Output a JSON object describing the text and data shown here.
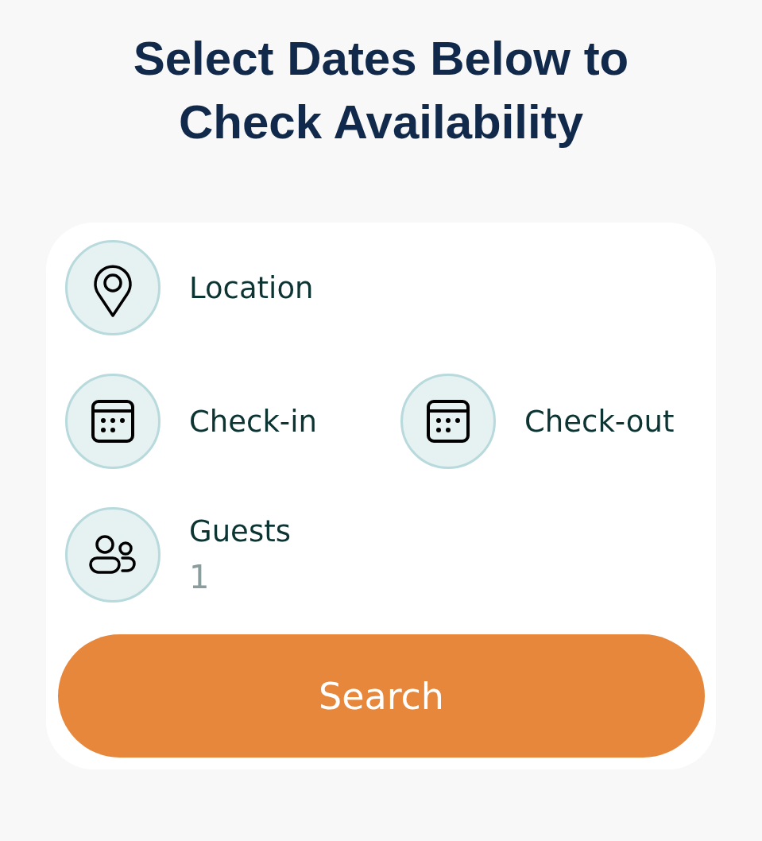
{
  "heading": "Select Dates Below to Check Availability",
  "search_form": {
    "location": {
      "label": "Location"
    },
    "dates": [
      {
        "label": "Check-in"
      },
      {
        "label": "Check-out"
      }
    ],
    "guests": {
      "label": "Guests",
      "placeholder": "1"
    },
    "search_button": "Search"
  }
}
